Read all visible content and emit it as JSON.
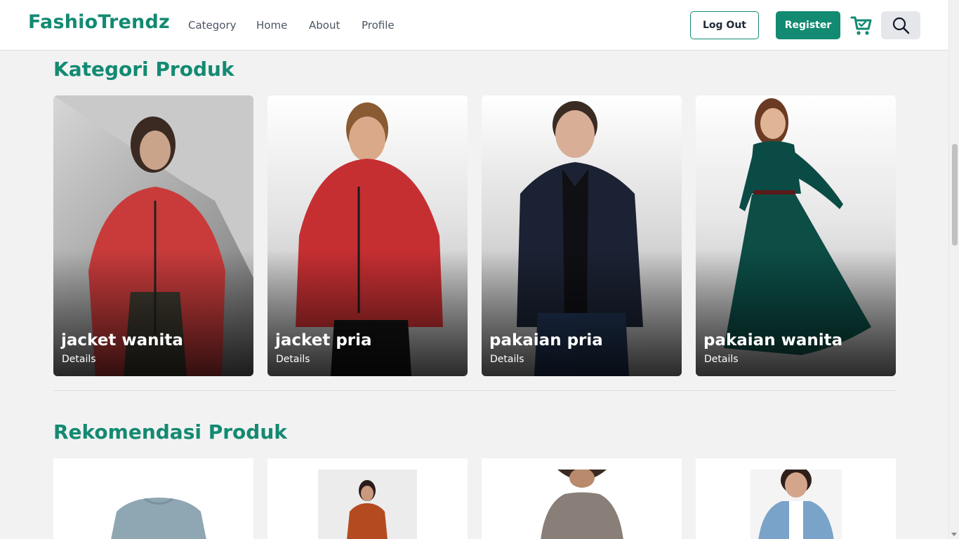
{
  "header": {
    "brand": "FashioTrendz",
    "nav": [
      "Category",
      "Home",
      "About",
      "Profile"
    ],
    "logout_label": "Log Out",
    "register_label": "Register",
    "cart_icon": "shopping-cart-icon",
    "search_icon": "search-icon"
  },
  "categories_section": {
    "title": "Kategori Produk",
    "items": [
      {
        "title": "jacket wanita",
        "details": "Details"
      },
      {
        "title": "jacket pria",
        "details": "Details"
      },
      {
        "title": "pakaian pria",
        "details": "Details"
      },
      {
        "title": "pakaian wanita",
        "details": "Details"
      }
    ]
  },
  "recommendations_section": {
    "title": "Rekomendasi Produk"
  },
  "colors": {
    "brand": "#138a72",
    "background": "#f2f2f2"
  }
}
